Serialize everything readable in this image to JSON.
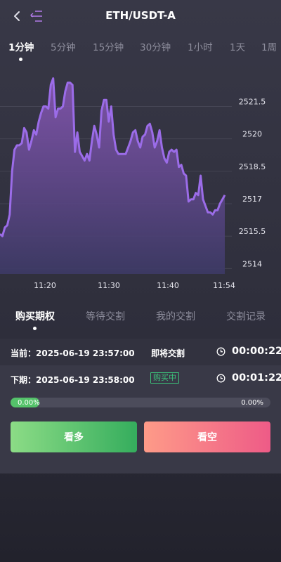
{
  "header": {
    "title": "ETH/USDT-A",
    "back_icon": "chevron-left-icon",
    "menu_icon": "menu-icon"
  },
  "timeframes": [
    {
      "label": "1分钟",
      "active": true
    },
    {
      "label": "5分钟",
      "active": false
    },
    {
      "label": "15分钟",
      "active": false
    },
    {
      "label": "30分钟",
      "active": false
    },
    {
      "label": "1小时",
      "active": false
    },
    {
      "label": "1天",
      "active": false
    },
    {
      "label": "1周",
      "active": false
    }
  ],
  "chart_data": {
    "type": "area",
    "x_ticks": [
      "11:20",
      "11:30",
      "11:40",
      "11:54"
    ],
    "y_ticks": [
      2514,
      2515.5,
      2517,
      2518.5,
      2520,
      2521.5
    ],
    "ylim": [
      2513.75,
      2523.5
    ],
    "grid": true,
    "line_color": "#9b6ce8",
    "values": [
      2515.6,
      2515.5,
      2515.9,
      2516.0,
      2516.5,
      2518.5,
      2519.5,
      2519.7,
      2519.7,
      2519.8,
      2520.5,
      2520.3,
      2519.5,
      2519.9,
      2520.4,
      2520.2,
      2520.8,
      2521.2,
      2521.5,
      2521.5,
      2521.4,
      2522.5,
      2522.8,
      2521.0,
      2521.4,
      2521.4,
      2521.5,
      2522.2,
      2522.6,
      2522.6,
      2522.5,
      2519.4,
      2520.3,
      2519.4,
      2519.2,
      2519.0,
      2519.3,
      2519.0,
      2519.9,
      2520.6,
      2520.2,
      2519.6,
      2521.3,
      2521.8,
      2521.8,
      2520.8,
      2521.5,
      2520.2,
      2519.5,
      2519.3,
      2519.3,
      2519.3,
      2519.3,
      2519.6,
      2519.9,
      2520.3,
      2520.4,
      2519.9,
      2519.6,
      2520.1,
      2520.2,
      2520.6,
      2520.7,
      2520.3,
      2519.6,
      2519.9,
      2520.4,
      2519.6,
      2519.1,
      2518.9,
      2519.4,
      2519.5,
      2519.4,
      2519.5,
      2518.7,
      2518.8,
      2518.4,
      2518.3,
      2517.1,
      2517.2,
      2517.2,
      2517.5,
      2517.4,
      2518.3,
      2517.2,
      2516.9,
      2516.6,
      2516.6,
      2516.5,
      2516.7,
      2516.7,
      2517.0,
      2517.2,
      2517.4
    ]
  },
  "option_tabs": [
    {
      "label": "购买期权",
      "active": true
    },
    {
      "label": "等待交割",
      "active": false
    },
    {
      "label": "我的交割",
      "active": false
    },
    {
      "label": "交割记录",
      "active": false
    }
  ],
  "current": {
    "label": "当前：2025-06-19 23:57:00",
    "status": "即将交割",
    "countdown": "00:00:22"
  },
  "next": {
    "label": "下期：2025-06-19 23:58:00",
    "status": "购买中",
    "countdown": "00:01:22"
  },
  "progress": {
    "left": "0.00%",
    "right": "0.00%",
    "up_fill": 0.11
  },
  "buttons": {
    "long": "看多",
    "short": "看空"
  },
  "colors": {
    "up": "#35ad5d",
    "down": "#ee5b87",
    "badge": "#3cc27a"
  }
}
